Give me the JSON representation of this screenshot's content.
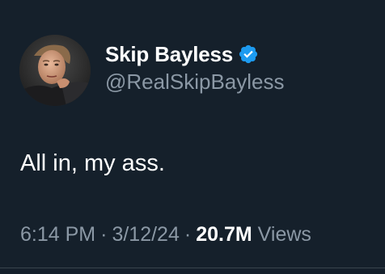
{
  "author": {
    "display_name": "Skip Bayless",
    "handle": "@RealSkipBayless",
    "verified": true
  },
  "tweet": {
    "text": "All in, my ass.",
    "time": "6:14 PM",
    "date": "3/12/24",
    "views_count": "20.7M",
    "views_label": "Views",
    "separator": "·"
  },
  "colors": {
    "background": "#15202b",
    "primary_text": "#ffffff",
    "secondary_text": "#8b98a5",
    "verified_badge": "#1d9bf0"
  },
  "icons": {
    "verified": "verified-badge-icon",
    "avatar": "profile-photo"
  }
}
